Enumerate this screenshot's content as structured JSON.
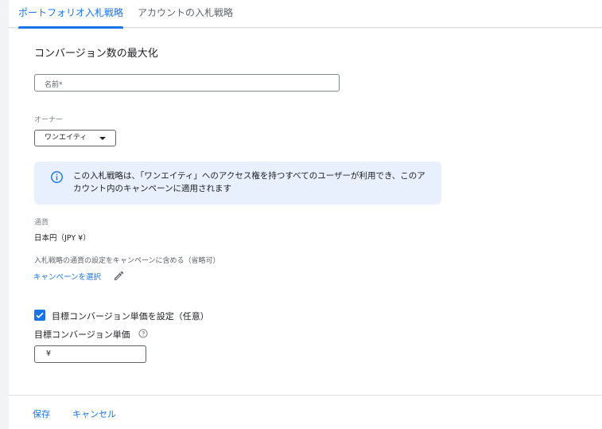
{
  "tabs": [
    {
      "label": "ポートフォリオ入札戦略",
      "active": true
    },
    {
      "label": "アカウントの入札戦略",
      "active": false
    }
  ],
  "form": {
    "title": "コンバージョン数の最大化",
    "name_placeholder": "名前*",
    "name_value": "",
    "owner_label": "オーナー",
    "owner_value": "ワンエイティ",
    "info_text": "この入札戦略は、「ワンエイティ」へのアクセス権を持つすべてのユーザーが利用でき、このアカウント内のキャンペーンに適用されます",
    "currency_label": "通貨",
    "currency_value": "日本円（JPY ¥）",
    "include_label": "入札戦略の通貨の設定をキャンペーンに含める（省略可）",
    "select_campaign_link": "キャンペーンを選択",
    "target_cpa_checkbox_label": "目標コンバージョン単価を設定（任意）",
    "target_cpa_checked": true,
    "target_cpa_label": "目標コンバージョン単価",
    "currency_symbol": "¥",
    "target_cpa_value": ""
  },
  "footer": {
    "save_label": "保存",
    "cancel_label": "キャンセル"
  },
  "colors": {
    "accent": "#1a73e8",
    "info_bg": "#e8f0fe"
  }
}
